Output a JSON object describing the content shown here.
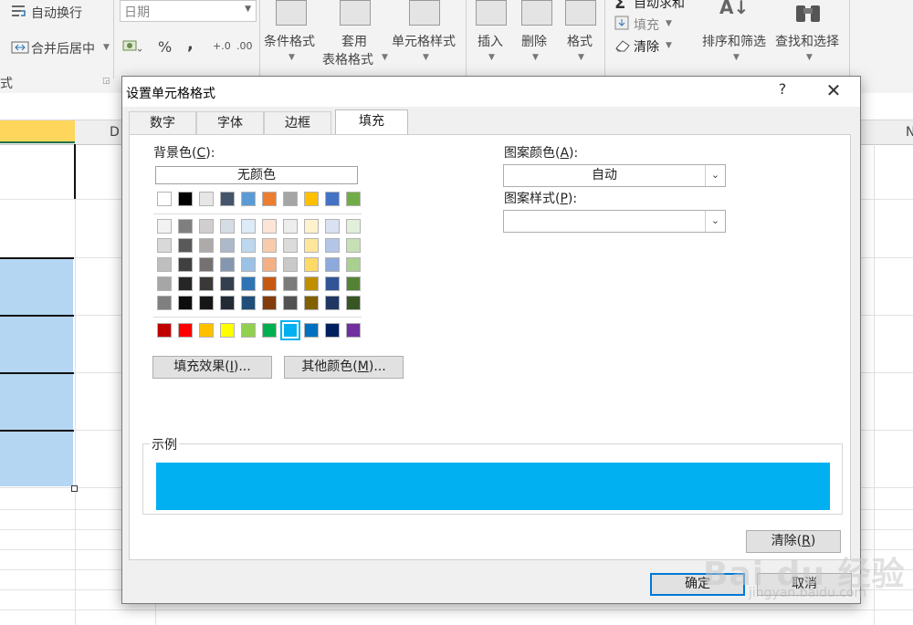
{
  "ribbon": {
    "wrap_text": "自动换行",
    "merge_center": "合并后居中",
    "number_format": "日期",
    "percent": "%",
    "comma": ",",
    "group_alignment": "式",
    "conditional_format": "条件格式",
    "table_format_1": "套用",
    "table_format_2": "表格格式",
    "cell_styles": "单元格样式",
    "insert": "插入",
    "delete": "删除",
    "format": "格式",
    "autosum": "自动求和",
    "fill": "填充",
    "clear": "清除",
    "sort_filter": "排序和筛选",
    "find_select": "查找和选择"
  },
  "sheet": {
    "col_d": "D",
    "col_n": "N"
  },
  "dialog": {
    "title": "设置单元格格式",
    "help": "?",
    "close": "✕",
    "tabs": [
      {
        "label": "数字"
      },
      {
        "label": "字体"
      },
      {
        "label": "边框"
      },
      {
        "label": "填充"
      }
    ],
    "active_tab": "填充",
    "background_color_label": "背景色(",
    "background_color_key": "C",
    "background_color_suffix": "):",
    "no_color": "无颜色",
    "pattern_color_label": "图案颜色(",
    "pattern_color_key": "A",
    "pattern_color_suffix": "):",
    "pattern_color_value": "自动",
    "pattern_style_label": "图案样式(",
    "pattern_style_key": "P",
    "pattern_style_suffix": "):",
    "pattern_style_value": "",
    "fill_effects_label": "填充效果(",
    "fill_effects_key": "I",
    "fill_effects_suffix": ")...",
    "more_colors_label": "其他颜色(",
    "more_colors_key": "M",
    "more_colors_suffix": ")...",
    "sample_label": "示例",
    "sample_color": "#00b0f0",
    "clear_label": "清除(",
    "clear_key": "R",
    "clear_suffix": ")",
    "ok": "确定",
    "cancel": "取消"
  },
  "palette": {
    "theme_row": [
      "#ffffff",
      "#000000",
      "#e7e6e6",
      "#44546a",
      "#5b9bd5",
      "#ed7d31",
      "#a5a5a5",
      "#ffc000",
      "#4472c4",
      "#70ad47"
    ],
    "shades": [
      [
        "#f2f2f2",
        "#7f7f7f",
        "#d0cece",
        "#d6dce4",
        "#ddebf7",
        "#fce4d6",
        "#ededed",
        "#fff2cc",
        "#d9e1f2",
        "#e2efda"
      ],
      [
        "#d9d9d9",
        "#595959",
        "#aeaaaa",
        "#acb9ca",
        "#bdd7ee",
        "#f8cbad",
        "#dbdbdb",
        "#ffe699",
        "#b4c6e7",
        "#c6e0b4"
      ],
      [
        "#bfbfbf",
        "#404040",
        "#757171",
        "#8497b0",
        "#9bc2e6",
        "#f4b084",
        "#c9c9c9",
        "#ffd966",
        "#8ea9db",
        "#a9d08e"
      ],
      [
        "#a6a6a6",
        "#262626",
        "#3a3838",
        "#333f4f",
        "#2f75b5",
        "#c65911",
        "#7b7b7b",
        "#bf8f00",
        "#305496",
        "#548235"
      ],
      [
        "#808080",
        "#0d0d0d",
        "#161616",
        "#222b35",
        "#1f4e78",
        "#833c0c",
        "#525252",
        "#806000",
        "#203764",
        "#375623"
      ]
    ],
    "standard_row": [
      "#c00000",
      "#ff0000",
      "#ffc000",
      "#ffff00",
      "#92d050",
      "#00b050",
      "#00b0f0",
      "#0070c0",
      "#002060",
      "#7030a0"
    ],
    "selected_standard_index": 6
  },
  "watermark": {
    "logo": "Bai du 经验",
    "url": "jingyan.baidu.com"
  }
}
